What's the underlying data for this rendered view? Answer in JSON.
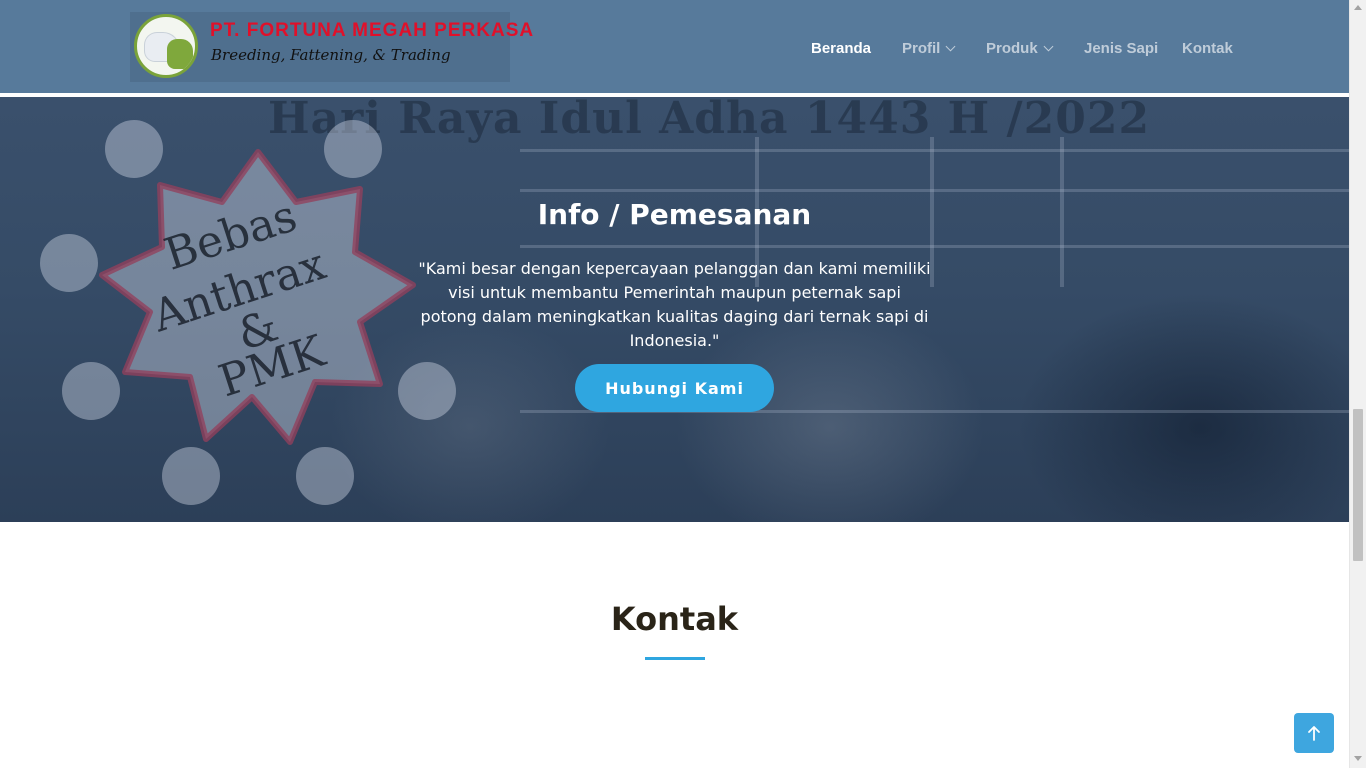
{
  "brand": {
    "name": "PT. FORTUNA MEGAH PERKASA",
    "tagline": "Breeding, Fattening, & Trading",
    "logo_icon": "cattle-logo-icon"
  },
  "nav": {
    "items": [
      {
        "label": "Beranda",
        "active": true,
        "dropdown": false
      },
      {
        "label": "Profil",
        "active": false,
        "dropdown": true
      },
      {
        "label": "Produk",
        "active": false,
        "dropdown": true
      },
      {
        "label": "Jenis Sapi",
        "active": false,
        "dropdown": false
      },
      {
        "label": "Kontak",
        "active": false,
        "dropdown": false
      }
    ]
  },
  "hero": {
    "banner_text": "Hari Raya Idul Adha 1443 H /2022",
    "stamp_lines": [
      "Bebas",
      "Anthrax",
      "&",
      "PMK"
    ],
    "title": "Info / Pemesanan",
    "quote": "\"Kami besar dengan kepercayaan pelanggan dan kami memiliki visi untuk membantu Pemerintah maupun peternak sapi potong dalam meningkatkan kualitas daging dari ternak sapi di Indonesia.\"",
    "button_label": "Hubungi Kami"
  },
  "contact": {
    "title": "Kontak"
  },
  "back_to_top": {
    "icon": "arrow-up-icon"
  },
  "colors": {
    "header_bg": "#577a9b",
    "accent": "#2fa6e0",
    "brand_red": "#e0102a",
    "brand_green": "#7fa83c"
  }
}
